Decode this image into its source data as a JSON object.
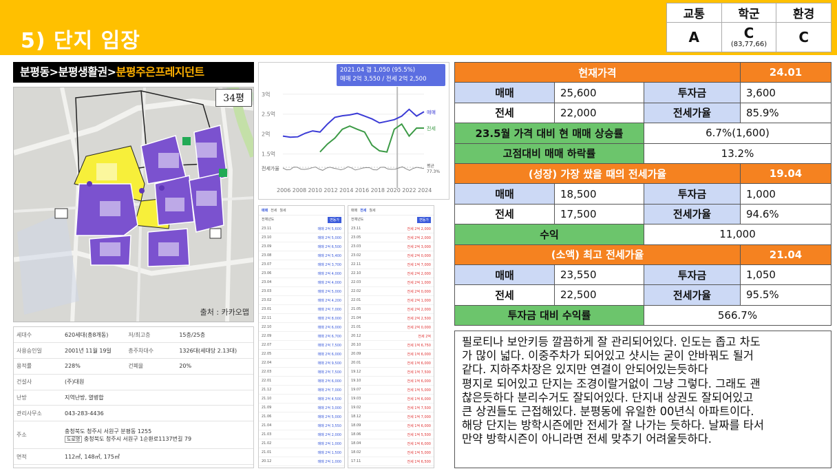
{
  "header": {
    "title": "5) 단지 임장",
    "grades": {
      "labels": [
        "교통",
        "학군",
        "환경"
      ],
      "values": [
        "A",
        "C",
        "C"
      ],
      "school_scores": "(83,77,66)"
    }
  },
  "breadcrumb": {
    "part1": "분평동>분평생활권>",
    "part2": "분평주은프레지던트"
  },
  "map": {
    "pyeong": "34평",
    "credit": "출처 : 카카오맵"
  },
  "info": {
    "households_label": "세대수",
    "households": "620세대(총8개동)",
    "floors_label": "저/최고층",
    "floors": "15층/25층",
    "approval_label": "사용승인일",
    "approval": "2001년 11월 19일",
    "parking_label": "총주차대수",
    "parking": "1326대(세대당 2.13대)",
    "far_label": "용적률",
    "far": "228%",
    "bcr_label": "건폐율",
    "bcr": "20%",
    "builder_label": "건설사",
    "builder": "(주)대원",
    "heating_label": "난방",
    "heating": "지역난방, 열병합",
    "office_label": "관리사무소",
    "office": "043-283-4436",
    "address_label": "주소",
    "address1": "충청북도 청주시 서원구 분평동 1255",
    "road_tag": "도로명",
    "address2": "충청북도 청주시 서원구 1순환로1137번길 79",
    "area_label": "면적",
    "area": "112㎡, 148㎡, 175㎡"
  },
  "chart_tooltip": {
    "line1": "2021.04  갭 1,050 (95.5%)",
    "line2": "매매 2억 3,550 / 전세 2억 2,500"
  },
  "chart_data": {
    "type": "line",
    "x": [
      "2006",
      "2008",
      "2010",
      "2012",
      "2014",
      "2016",
      "2018",
      "2020",
      "2022",
      "2024"
    ],
    "yticks": [
      "3억",
      "2.5억",
      "2억",
      "1.5억"
    ],
    "ylim": [
      1.2,
      3.1
    ],
    "series": [
      {
        "name": "매매",
        "color": "#3b3bd6",
        "values": [
          1.95,
          1.92,
          1.93,
          2.02,
          2.08,
          2.05,
          2.25,
          2.42,
          2.46,
          2.48,
          2.52,
          2.45,
          2.38,
          2.28,
          2.32,
          2.36,
          2.45,
          2.62,
          2.45,
          2.56
        ]
      },
      {
        "name": "전세",
        "color": "#3c9a46",
        "values": [
          null,
          null,
          null,
          null,
          null,
          1.55,
          1.75,
          1.9,
          2.12,
          2.2,
          2.12,
          2.05,
          1.72,
          1.58,
          1.55,
          2.12,
          2.25,
          1.95,
          2.15,
          2.15
        ]
      }
    ],
    "ratio_label": "전세가율",
    "ratio_value_label": "평균",
    "ratio_value": "77.3%"
  },
  "listings": {
    "tabs1": [
      "매매",
      "전세",
      "월세"
    ],
    "tabs2": [
      "매매",
      "전세",
      "월세"
    ],
    "filter": "전체년도",
    "button": "변동가",
    "rows1": [
      [
        "23.11",
        "매매 2억 5,600"
      ],
      [
        "23.10",
        "매매 2억 5,000"
      ],
      [
        "23.09",
        "매매 2억 6,500"
      ],
      [
        "23.08",
        "매매 2억 5,400"
      ],
      [
        "23.07",
        "매매 2억 3,700"
      ],
      [
        "23.06",
        "매매 2억 4,000"
      ],
      [
        "23.04",
        "매매 2억 4,000"
      ],
      [
        "23.03",
        "매매 2억 5,000"
      ],
      [
        "23.02",
        "매매 2억 4,200"
      ],
      [
        "23.01",
        "매매 2억 7,000"
      ],
      [
        "22.11",
        "매매 2억 8,000"
      ],
      [
        "22.10",
        "매매 2억 6,000"
      ],
      [
        "22.09",
        "매매 2억 6,700"
      ],
      [
        "22.07",
        "매매 2억 7,500"
      ],
      [
        "22.05",
        "매매 2억 6,000"
      ],
      [
        "22.04",
        "매매 2억 9,500"
      ],
      [
        "22.03",
        "매매 2억 7,500"
      ],
      [
        "22.01",
        "매매 2억 6,000"
      ],
      [
        "21.12",
        "매매 2억 7,000"
      ],
      [
        "21.10",
        "매매 2억 4,500"
      ],
      [
        "21.09",
        "매매 2억 3,000"
      ],
      [
        "21.06",
        "매매 2억 5,000"
      ],
      [
        "21.04",
        "매매 2억 3,550"
      ],
      [
        "21.03",
        "매매 2억 2,000"
      ],
      [
        "21.02",
        "매매 2억 1,000"
      ],
      [
        "21.01",
        "매매 2억 1,500"
      ],
      [
        "20.12",
        "매매 2억 1,000"
      ]
    ],
    "rows2": [
      [
        "23.11",
        "전세 2억 2,000"
      ],
      [
        "23.05",
        "전세 2억 2,000"
      ],
      [
        "23.03",
        "전세 2억 3,000"
      ],
      [
        "23.02",
        "전세 2억 0,000"
      ],
      [
        "22.11",
        "전세 1억 7,000"
      ],
      [
        "22.10",
        "전세 2억 2,000"
      ],
      [
        "22.03",
        "전세 2억 1,000"
      ],
      [
        "22.02",
        "전세 2억 0,000"
      ],
      [
        "22.01",
        "전세 2억 1,000"
      ],
      [
        "21.05",
        "전세 2억 2,000"
      ],
      [
        "21.04",
        "전세 2억 2,500"
      ],
      [
        "21.01",
        "전세 2억 0,000"
      ],
      [
        "20.12",
        "전세 2억"
      ],
      [
        "20.10",
        "전세 1억 6,750"
      ],
      [
        "20.09",
        "전세 1억 6,000"
      ],
      [
        "20.01",
        "전세 1억 6,000"
      ],
      [
        "19.12",
        "전세 1억 7,500"
      ],
      [
        "19.10",
        "전세 1억 6,000"
      ],
      [
        "19.07",
        "전세 1억 5,000"
      ],
      [
        "19.03",
        "전세 1억 6,000"
      ],
      [
        "19.02",
        "전세 1억 7,500"
      ],
      [
        "18.12",
        "전세 1억 7,000"
      ],
      [
        "18.09",
        "전세 1억 6,000"
      ],
      [
        "18.06",
        "전세 1억 5,500"
      ],
      [
        "18.04",
        "전세 1억 6,000"
      ],
      [
        "18.02",
        "전세 1억 5,000"
      ],
      [
        "17.11",
        "전세 1억 6,500"
      ]
    ]
  },
  "summary": {
    "current_label": "현재가격",
    "current_date": "24.01",
    "sale_label": "매매",
    "jeonse_label": "전세",
    "invest_label": "투자금",
    "ratio_label": "전세가율",
    "current_sale": "25,600",
    "current_invest": "3,600",
    "current_jeonse": "22,000",
    "current_ratio": "85.9%",
    "rise_label": "23.5월 가격 대비 현 매매 상승률",
    "rise_value": "6.7%(1,600)",
    "drop_label": "고점대비 매매 하락률",
    "drop_value": "13.2%",
    "growth_label": "(성장) 가장 쌌을 때의 전세가율",
    "growth_date": "19.04",
    "growth_sale": "18,500",
    "growth_invest": "1,000",
    "growth_jeonse": "17,500",
    "growth_ratio": "94.6%",
    "profit_label": "수익",
    "profit_value": "11,000",
    "peak_label": "(소액) 최고 전세가율",
    "peak_date": "21.04",
    "peak_sale": "23,550",
    "peak_invest": "1,050",
    "peak_jeonse": "22,500",
    "peak_ratio": "95.5%",
    "roi_label": "투자금 대비 수익률",
    "roi_value": "566.7%"
  },
  "memo": {
    "lines": [
      "필로티나 보안키등 깔끔하게 잘 관리되어있다. 인도는 좁고 차도",
      "가 많이 넓다. 이중주차가 되어있고 샷시는 굳이 안바꿔도 될거",
      "같다. 지하주차장은 있지만 연결이 안되어있는듯하다",
      "평지로 되어있고 단지는 조경이랄거없이 그냥 그렇다. 그래도 괜",
      "찮은듯하다 분리수거도 잘되어있다. 단지내 상권도 잘되어있고",
      "큰 상권들도 근접해있다. 분평동에 유일한 00년식 아파트이다.",
      "해당 단지는 방학시즌에만 전세가 잘 나가는 듯하다. 날짜를 타서",
      "만약 방학시즌이 아니라면 전세 맞추기 어려울듯하다."
    ]
  }
}
